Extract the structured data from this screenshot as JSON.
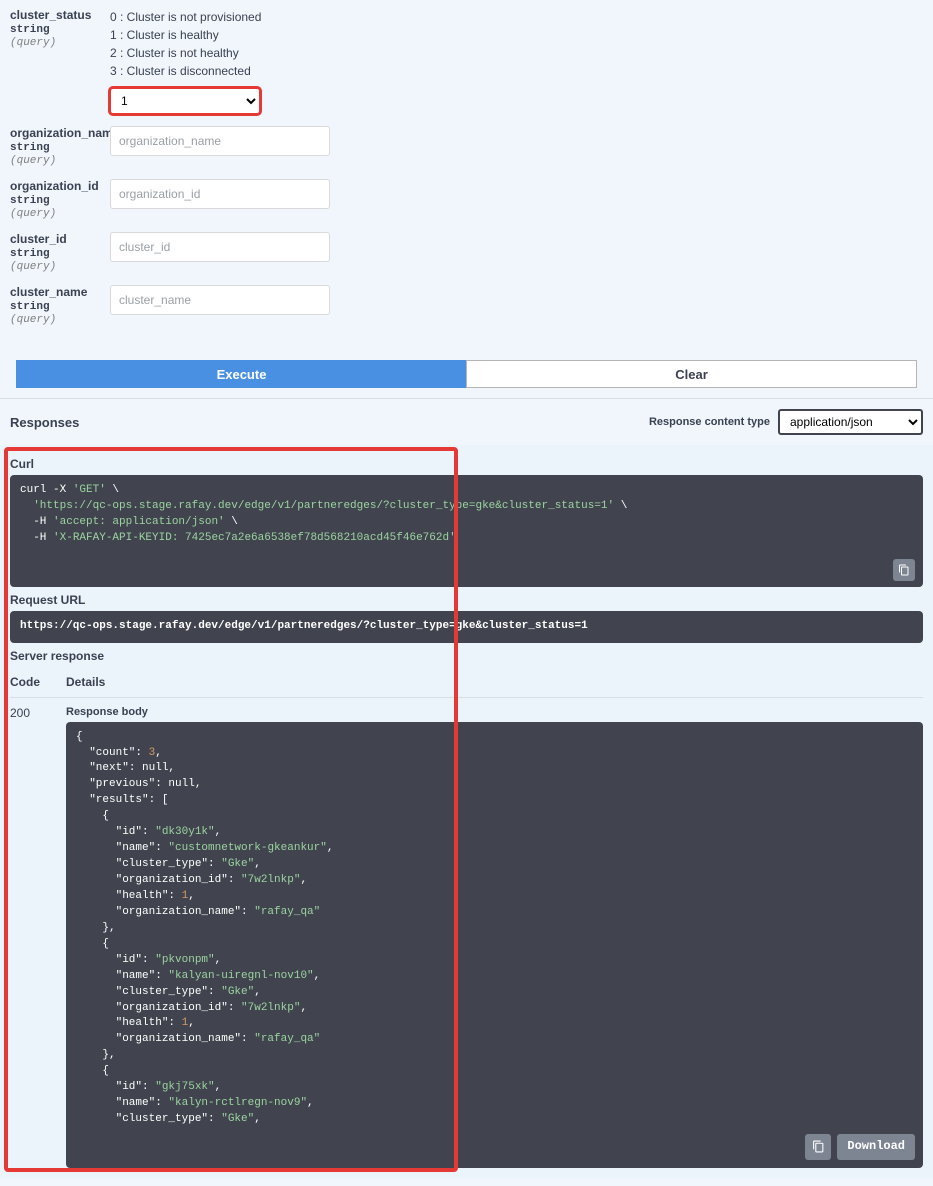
{
  "params": {
    "cluster_status": {
      "name": "cluster_status",
      "type": "string",
      "in": "(query)",
      "enum_lines": [
        "0 : Cluster is not provisioned",
        "1 : Cluster is healthy",
        "2 : Cluster is not healthy",
        "3 : Cluster is disconnected"
      ],
      "value": "1"
    },
    "organization_name": {
      "name": "organization_name",
      "type": "string",
      "in": "(query)",
      "placeholder": "organization_name"
    },
    "organization_id": {
      "name": "organization_id",
      "type": "string",
      "in": "(query)",
      "placeholder": "organization_id"
    },
    "cluster_id": {
      "name": "cluster_id",
      "type": "string",
      "in": "(query)",
      "placeholder": "cluster_id"
    },
    "cluster_name": {
      "name": "cluster_name",
      "type": "string",
      "in": "(query)",
      "placeholder": "cluster_name"
    }
  },
  "buttons": {
    "execute": "Execute",
    "clear": "Clear",
    "download": "Download"
  },
  "responses": {
    "title": "Responses",
    "content_type_label": "Response content type",
    "content_type_value": "application/json"
  },
  "labels": {
    "curl": "Curl",
    "request_url": "Request URL",
    "server_response": "Server response",
    "code": "Code",
    "details": "Details",
    "response_body": "Response body"
  },
  "curl_lines": [
    {
      "prefix": "curl -X ",
      "method": "'GET'",
      "suffix": " \\"
    },
    {
      "url": "'https://qc-ops.stage.rafay.dev/edge/v1/partneredges/?cluster_type=gke&cluster_status=1'",
      "suffix": " \\"
    },
    {
      "flag": "  -H ",
      "val": "'accept: application/json'",
      "suffix": " \\"
    },
    {
      "flag": "  -H ",
      "val": "'X-RAFAY-API-KEYID: 7425ec7a2e6a6538ef78d568210acd45f46e762d'"
    }
  ],
  "request_url": "https://qc-ops.stage.rafay.dev/edge/v1/partneredges/?cluster_type=gke&cluster_status=1",
  "response": {
    "code": "200",
    "body": {
      "count": 3,
      "next": null,
      "previous": null,
      "results": [
        {
          "id": "dk30y1k",
          "name": "customnetwork-gkeankur",
          "cluster_type": "Gke",
          "organization_id": "7w2lnkp",
          "health": 1,
          "organization_name": "rafay_qa"
        },
        {
          "id": "pkvonpm",
          "name": "kalyan-uiregnl-nov10",
          "cluster_type": "Gke",
          "organization_id": "7w2lnkp",
          "health": 1,
          "organization_name": "rafay_qa"
        },
        {
          "id": "gkj75xk",
          "name": "kalyn-rctlregn-nov9",
          "cluster_type": "Gke"
        }
      ]
    }
  }
}
